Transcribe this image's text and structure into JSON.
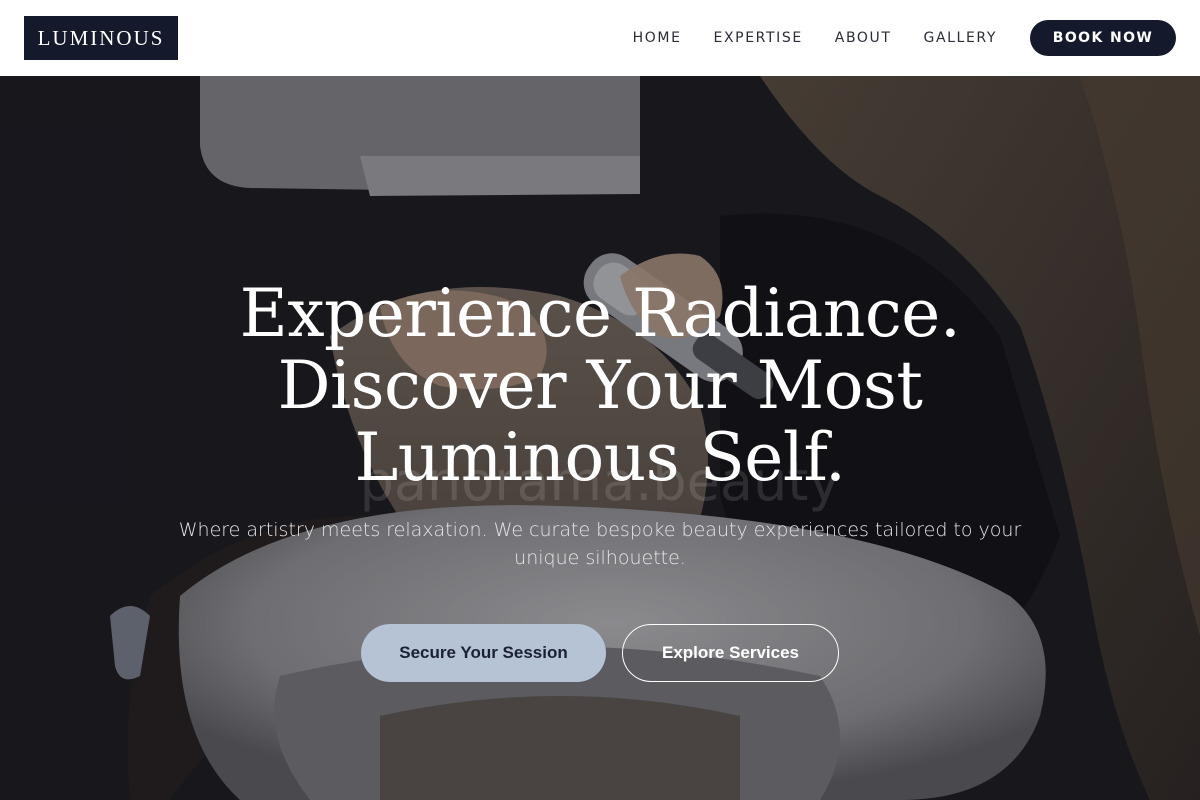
{
  "brand": {
    "logo_text": "LUMINOUS"
  },
  "nav": {
    "items": [
      {
        "label": "HOME"
      },
      {
        "label": "EXPERTISE"
      },
      {
        "label": "ABOUT"
      },
      {
        "label": "GALLERY"
      }
    ],
    "cta_label": "BOOK NOW"
  },
  "hero": {
    "headline_lines": [
      "Experience Radiance.",
      "Discover Your Most",
      "Luminous Self."
    ],
    "subtext": "Where artistry meets relaxation. We curate bespoke beauty experiences tailored to your unique silhouette.",
    "primary_cta": "Secure Your Session",
    "secondary_cta": "Explore Services",
    "watermark": "panorama.beauty",
    "background_image": "salon-hair-wash-photo"
  },
  "colors": {
    "navy": "#141a2c",
    "primary_button": "#b6c3d4",
    "white": "#ffffff"
  }
}
